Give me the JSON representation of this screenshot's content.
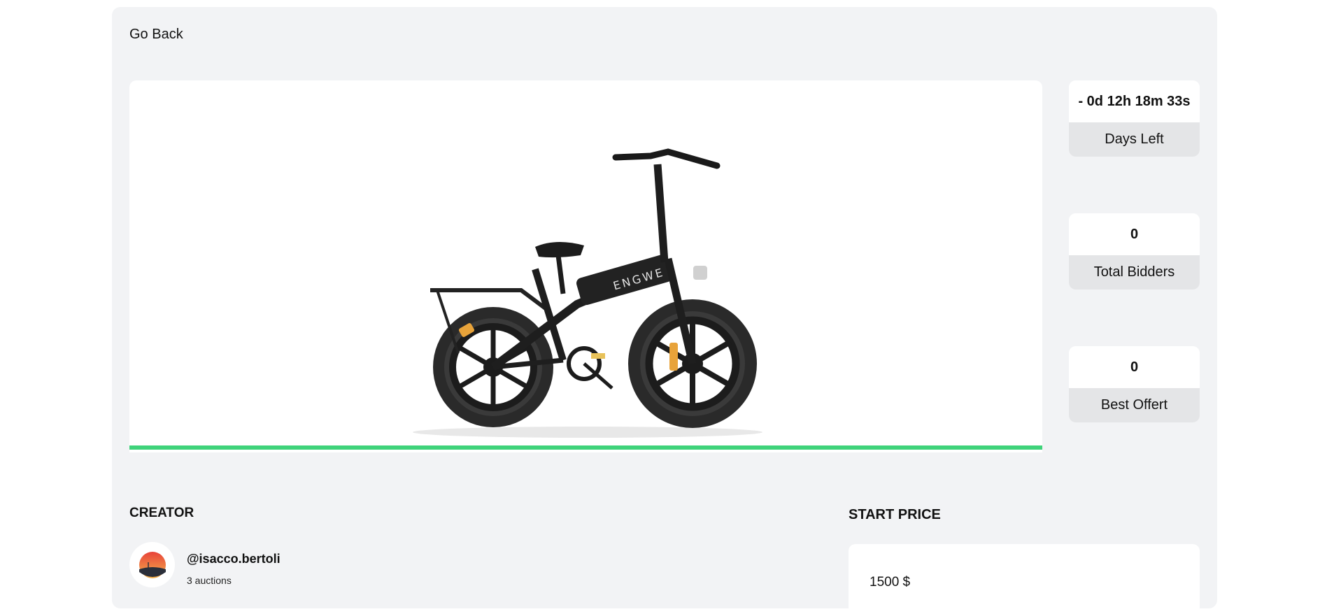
{
  "nav": {
    "go_back_label": "Go Back"
  },
  "stats": {
    "time_left": {
      "value": "- 0d 12h 18m 33s",
      "label": "Days Left"
    },
    "total_bidders": {
      "value": "0",
      "label": "Total Bidders"
    },
    "best_offer": {
      "value": "0",
      "label": "Best Offert"
    }
  },
  "progress": {
    "fraction": 1.0,
    "color": "#3fd37a"
  },
  "product": {
    "image_icon": "electric-folding-bike-image",
    "brand_text": "ENGWE"
  },
  "creator": {
    "section_title": "CREATOR",
    "username": "@isacco.bertoli",
    "auctions": "3 auctions",
    "avatar_icon": "sunset-avatar"
  },
  "price": {
    "section_title": "START PRICE",
    "value": "1500 $"
  },
  "colors": {
    "panel_bg": "#f2f3f5",
    "label_bg": "#e4e5e7",
    "accent_green": "#3fd37a"
  }
}
